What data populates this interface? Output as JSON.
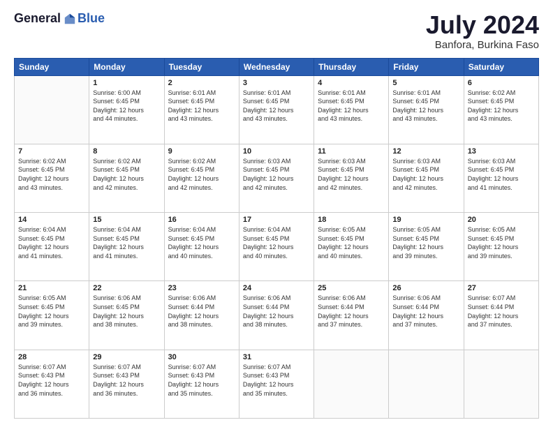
{
  "header": {
    "logo_general": "General",
    "logo_blue": "Blue",
    "month_year": "July 2024",
    "location": "Banfora, Burkina Faso"
  },
  "days_of_week": [
    "Sunday",
    "Monday",
    "Tuesday",
    "Wednesday",
    "Thursday",
    "Friday",
    "Saturday"
  ],
  "weeks": [
    [
      {
        "day": "",
        "info": ""
      },
      {
        "day": "1",
        "info": "Sunrise: 6:00 AM\nSunset: 6:45 PM\nDaylight: 12 hours\nand 44 minutes."
      },
      {
        "day": "2",
        "info": "Sunrise: 6:01 AM\nSunset: 6:45 PM\nDaylight: 12 hours\nand 43 minutes."
      },
      {
        "day": "3",
        "info": "Sunrise: 6:01 AM\nSunset: 6:45 PM\nDaylight: 12 hours\nand 43 minutes."
      },
      {
        "day": "4",
        "info": "Sunrise: 6:01 AM\nSunset: 6:45 PM\nDaylight: 12 hours\nand 43 minutes."
      },
      {
        "day": "5",
        "info": "Sunrise: 6:01 AM\nSunset: 6:45 PM\nDaylight: 12 hours\nand 43 minutes."
      },
      {
        "day": "6",
        "info": "Sunrise: 6:02 AM\nSunset: 6:45 PM\nDaylight: 12 hours\nand 43 minutes."
      }
    ],
    [
      {
        "day": "7",
        "info": "Sunrise: 6:02 AM\nSunset: 6:45 PM\nDaylight: 12 hours\nand 43 minutes."
      },
      {
        "day": "8",
        "info": "Sunrise: 6:02 AM\nSunset: 6:45 PM\nDaylight: 12 hours\nand 42 minutes."
      },
      {
        "day": "9",
        "info": "Sunrise: 6:02 AM\nSunset: 6:45 PM\nDaylight: 12 hours\nand 42 minutes."
      },
      {
        "day": "10",
        "info": "Sunrise: 6:03 AM\nSunset: 6:45 PM\nDaylight: 12 hours\nand 42 minutes."
      },
      {
        "day": "11",
        "info": "Sunrise: 6:03 AM\nSunset: 6:45 PM\nDaylight: 12 hours\nand 42 minutes."
      },
      {
        "day": "12",
        "info": "Sunrise: 6:03 AM\nSunset: 6:45 PM\nDaylight: 12 hours\nand 42 minutes."
      },
      {
        "day": "13",
        "info": "Sunrise: 6:03 AM\nSunset: 6:45 PM\nDaylight: 12 hours\nand 41 minutes."
      }
    ],
    [
      {
        "day": "14",
        "info": "Sunrise: 6:04 AM\nSunset: 6:45 PM\nDaylight: 12 hours\nand 41 minutes."
      },
      {
        "day": "15",
        "info": "Sunrise: 6:04 AM\nSunset: 6:45 PM\nDaylight: 12 hours\nand 41 minutes."
      },
      {
        "day": "16",
        "info": "Sunrise: 6:04 AM\nSunset: 6:45 PM\nDaylight: 12 hours\nand 40 minutes."
      },
      {
        "day": "17",
        "info": "Sunrise: 6:04 AM\nSunset: 6:45 PM\nDaylight: 12 hours\nand 40 minutes."
      },
      {
        "day": "18",
        "info": "Sunrise: 6:05 AM\nSunset: 6:45 PM\nDaylight: 12 hours\nand 40 minutes."
      },
      {
        "day": "19",
        "info": "Sunrise: 6:05 AM\nSunset: 6:45 PM\nDaylight: 12 hours\nand 39 minutes."
      },
      {
        "day": "20",
        "info": "Sunrise: 6:05 AM\nSunset: 6:45 PM\nDaylight: 12 hours\nand 39 minutes."
      }
    ],
    [
      {
        "day": "21",
        "info": "Sunrise: 6:05 AM\nSunset: 6:45 PM\nDaylight: 12 hours\nand 39 minutes."
      },
      {
        "day": "22",
        "info": "Sunrise: 6:06 AM\nSunset: 6:45 PM\nDaylight: 12 hours\nand 38 minutes."
      },
      {
        "day": "23",
        "info": "Sunrise: 6:06 AM\nSunset: 6:44 PM\nDaylight: 12 hours\nand 38 minutes."
      },
      {
        "day": "24",
        "info": "Sunrise: 6:06 AM\nSunset: 6:44 PM\nDaylight: 12 hours\nand 38 minutes."
      },
      {
        "day": "25",
        "info": "Sunrise: 6:06 AM\nSunset: 6:44 PM\nDaylight: 12 hours\nand 37 minutes."
      },
      {
        "day": "26",
        "info": "Sunrise: 6:06 AM\nSunset: 6:44 PM\nDaylight: 12 hours\nand 37 minutes."
      },
      {
        "day": "27",
        "info": "Sunrise: 6:07 AM\nSunset: 6:44 PM\nDaylight: 12 hours\nand 37 minutes."
      }
    ],
    [
      {
        "day": "28",
        "info": "Sunrise: 6:07 AM\nSunset: 6:43 PM\nDaylight: 12 hours\nand 36 minutes."
      },
      {
        "day": "29",
        "info": "Sunrise: 6:07 AM\nSunset: 6:43 PM\nDaylight: 12 hours\nand 36 minutes."
      },
      {
        "day": "30",
        "info": "Sunrise: 6:07 AM\nSunset: 6:43 PM\nDaylight: 12 hours\nand 35 minutes."
      },
      {
        "day": "31",
        "info": "Sunrise: 6:07 AM\nSunset: 6:43 PM\nDaylight: 12 hours\nand 35 minutes."
      },
      {
        "day": "",
        "info": ""
      },
      {
        "day": "",
        "info": ""
      },
      {
        "day": "",
        "info": ""
      }
    ]
  ]
}
